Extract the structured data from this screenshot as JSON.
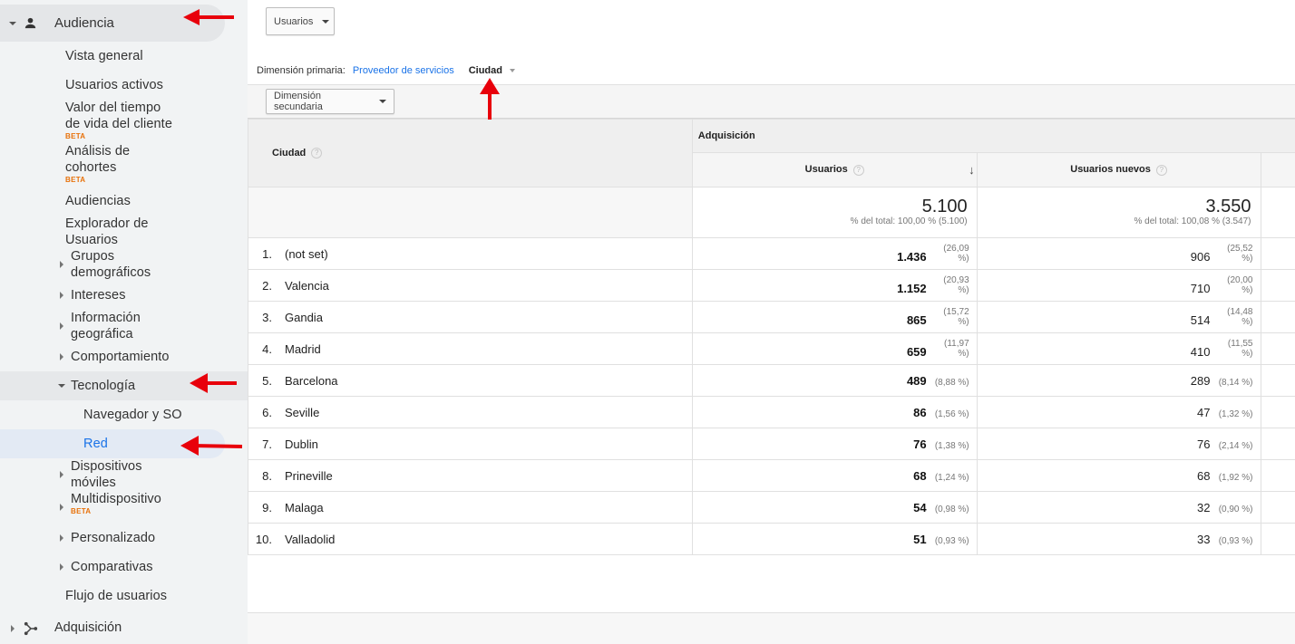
{
  "sidebar": {
    "audiencia": "Audiencia",
    "adquisicion": "Adquisición",
    "items": {
      "vista_general": "Vista general",
      "usuarios_activos": "Usuarios activos",
      "valor_l1": "Valor del tiempo",
      "valor_l2": "de vida del cliente",
      "cohortes_l1": "Análisis de",
      "cohortes_l2": "cohortes",
      "audiencias": "Audiencias",
      "explorador_l1": "Explorador de",
      "explorador_l2": "Usuarios",
      "grupos_l1": "Grupos",
      "grupos_l2": "demográficos",
      "intereses": "Intereses",
      "info_l1": "Información",
      "info_l2": "geográfica",
      "comportamiento": "Comportamiento",
      "tecnologia": "Tecnología",
      "navegador": "Navegador y SO",
      "red": "Red",
      "dispositivos_l1": "Dispositivos",
      "dispositivos_l2": "móviles",
      "multidispositivo": "Multidispositivo",
      "personalizado": "Personalizado",
      "comparativas": "Comparativas",
      "flujo": "Flujo de usuarios"
    },
    "beta_label": "BETA"
  },
  "controls": {
    "metric_select": "Usuarios",
    "primary_label": "Dimensión primaria:",
    "primary_link": "Proveedor de servicios",
    "primary_active": "Ciudad",
    "secondary_select": "Dimensión secundaria"
  },
  "table": {
    "dimension_header": "Ciudad",
    "group_header": "Adquisición",
    "col_users": "Usuarios",
    "col_new_users": "Usuarios nuevos",
    "totals": {
      "users": "5.100",
      "users_sub": "% del total: 100,00 % (5.100)",
      "new_users": "3.550",
      "new_users_sub": "% del total: 100,08 % (3.547)"
    },
    "rows": [
      {
        "rank": "1.",
        "city": "(not set)",
        "users": "1.436",
        "users_pct": "(26,09 %)",
        "new": "906",
        "new_pct": "(25,52 %)"
      },
      {
        "rank": "2.",
        "city": "Valencia",
        "users": "1.152",
        "users_pct": "(20,93 %)",
        "new": "710",
        "new_pct": "(20,00 %)"
      },
      {
        "rank": "3.",
        "city": "Gandia",
        "users": "865",
        "users_pct": "(15,72 %)",
        "new": "514",
        "new_pct": "(14,48 %)"
      },
      {
        "rank": "4.",
        "city": "Madrid",
        "users": "659",
        "users_pct": "(11,97 %)",
        "new": "410",
        "new_pct": "(11,55 %)"
      },
      {
        "rank": "5.",
        "city": "Barcelona",
        "users": "489",
        "users_pct": "(8,88 %)",
        "new": "289",
        "new_pct": "(8,14 %)"
      },
      {
        "rank": "6.",
        "city": "Seville",
        "users": "86",
        "users_pct": "(1,56 %)",
        "new": "47",
        "new_pct": "(1,32 %)"
      },
      {
        "rank": "7.",
        "city": "Dublin",
        "users": "76",
        "users_pct": "(1,38 %)",
        "new": "76",
        "new_pct": "(2,14 %)"
      },
      {
        "rank": "8.",
        "city": "Prineville",
        "users": "68",
        "users_pct": "(1,24 %)",
        "new": "68",
        "new_pct": "(1,92 %)"
      },
      {
        "rank": "9.",
        "city": "Malaga",
        "users": "54",
        "users_pct": "(0,98 %)",
        "new": "32",
        "new_pct": "(0,90 %)"
      },
      {
        "rank": "10.",
        "city": "Valladolid",
        "users": "51",
        "users_pct": "(0,93 %)",
        "new": "33",
        "new_pct": "(0,93 %)"
      }
    ]
  },
  "colors": {
    "annotation_arrow": "#e8000b",
    "link": "#1a73e8",
    "beta": "#e8710a"
  }
}
